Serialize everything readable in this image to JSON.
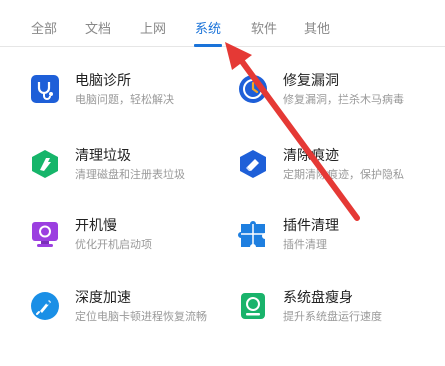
{
  "tabs": [
    {
      "label": "全部"
    },
    {
      "label": "文档"
    },
    {
      "label": "上网"
    },
    {
      "label": "系统"
    },
    {
      "label": "软件"
    },
    {
      "label": "其他"
    }
  ],
  "active_tab": "系统",
  "accent_color": "#1a73d9",
  "arrow_color": "#e53935",
  "tools": [
    {
      "title": "电脑诊所",
      "desc": "电脑问题，轻松解决",
      "icon": "stethoscope-icon",
      "color": "#1e5fd8"
    },
    {
      "title": "修复漏洞",
      "desc": "修复漏洞，拦杀木马病毒",
      "icon": "shield-repair-icon",
      "color": "#1e5fd8"
    },
    {
      "title": "清理垃圾",
      "desc": "清理磁盘和注册表垃圾",
      "icon": "broom-icon",
      "color": "#16b56a"
    },
    {
      "title": "清除痕迹",
      "desc": "定期清除痕迹，保护隐私",
      "icon": "eraser-icon",
      "color": "#1e5fd8"
    },
    {
      "title": "开机慢",
      "desc": "优化开机启动项",
      "icon": "monitor-icon",
      "color": "#9b3fe0"
    },
    {
      "title": "插件清理",
      "desc": "插件清理",
      "icon": "puzzle-icon",
      "color": "#1e7fe0"
    },
    {
      "title": "深度加速",
      "desc": "定位电脑卡顿进程恢复流畅",
      "icon": "rocket-icon",
      "color": "#1a8fe6"
    },
    {
      "title": "系统盘瘦身",
      "desc": "提升系统盘运行速度",
      "icon": "disk-icon",
      "color": "#19b36b"
    }
  ]
}
